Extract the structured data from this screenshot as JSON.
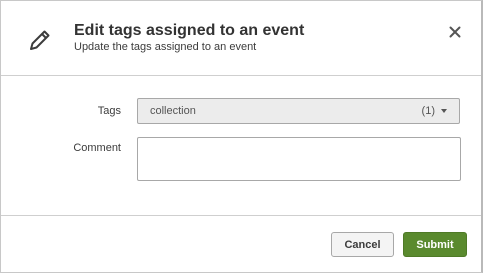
{
  "dialog": {
    "title": "Edit tags assigned to an event",
    "subtitle": "Update the tags assigned to an event",
    "icon": "pencil-icon",
    "close_icon": "close-icon"
  },
  "form": {
    "tags_label": "Tags",
    "tags_value": "collection",
    "tags_count": "(1)",
    "comment_label": "Comment",
    "comment_value": ""
  },
  "footer": {
    "cancel_label": "Cancel",
    "submit_label": "Submit"
  },
  "colors": {
    "submit_bg": "#5a8a2e",
    "select_bg": "#ececec"
  }
}
